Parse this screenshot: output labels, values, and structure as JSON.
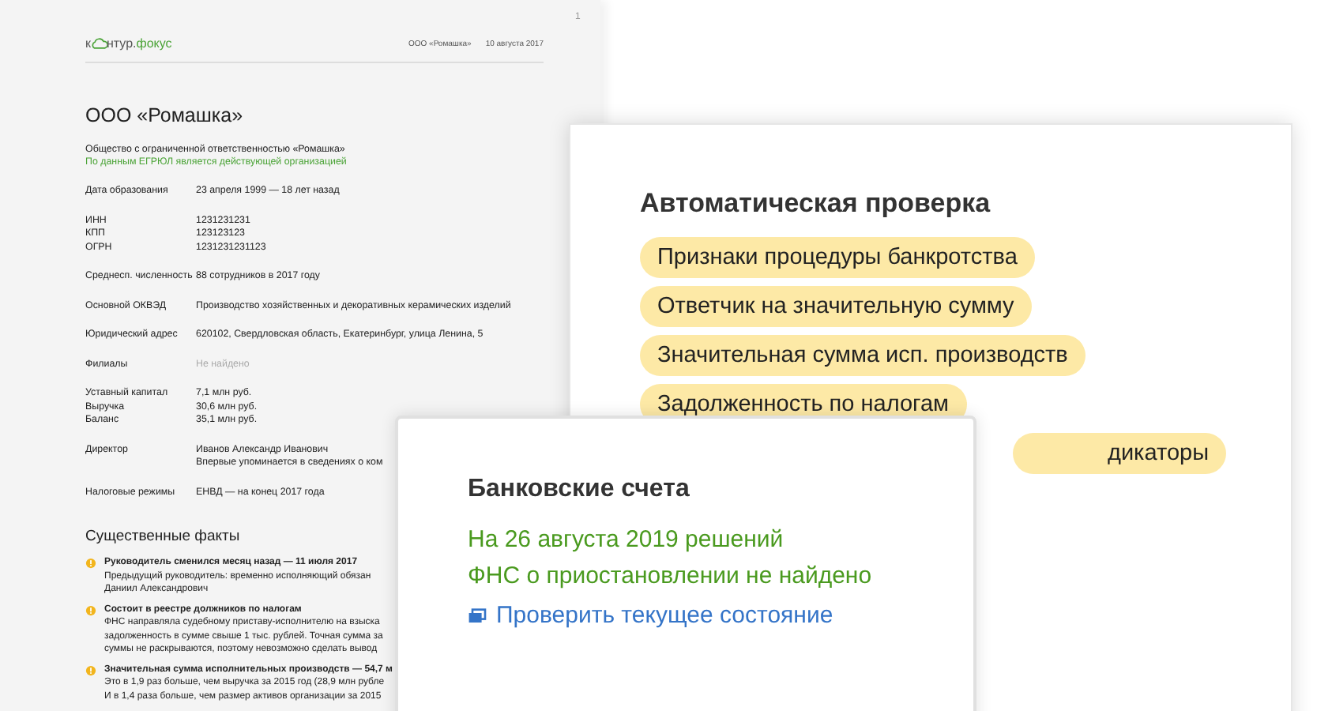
{
  "document": {
    "page_number": "1",
    "logo": {
      "start": "к",
      "middle": "нтур.",
      "product": "фокус"
    },
    "header_company": "ООО «Ромашка»",
    "header_date": "10 августа 2017",
    "title": "ООО «Ромашка»",
    "full_name": "Общество с ограниченной ответственностью «Ромашка»",
    "status": "По данным ЕГРЮЛ является действующей организацией",
    "groups": [
      {
        "rows": [
          {
            "label": "Дата образования",
            "value": "23 апреля 1999 — 18 лет назад",
            "muted": false
          }
        ]
      },
      {
        "rows": [
          {
            "label": "ИНН",
            "value": "1231231231",
            "muted": false
          },
          {
            "label": "КПП",
            "value": "123123123",
            "muted": false
          },
          {
            "label": "ОГРН",
            "value": "1231231231123",
            "muted": false
          }
        ]
      },
      {
        "rows": [
          {
            "label": "Среднесп. численность",
            "value": "88 сотрудников в 2017 году",
            "muted": false
          }
        ]
      },
      {
        "rows": [
          {
            "label": "Основной ОКВЭД",
            "value": "Производство хозяйственных и декоративных керамических изделий",
            "muted": false
          }
        ]
      },
      {
        "rows": [
          {
            "label": "Юридический адрес",
            "value": "620102, Свердловская область, Екатеринбург, улица Ленина, 5",
            "muted": false
          }
        ]
      },
      {
        "rows": [
          {
            "label": "Филиалы",
            "value": "Не найдено",
            "muted": true
          }
        ]
      },
      {
        "rows": [
          {
            "label": "Уставный капитал",
            "value": "7,1 млн руб.",
            "muted": false
          },
          {
            "label": "Выручка",
            "value": "30,6 млн руб.",
            "muted": false
          },
          {
            "label": "Баланс",
            "value": "35,1 млн руб.",
            "muted": false
          }
        ]
      },
      {
        "rows": [
          {
            "label": "Директор",
            "value": "Иванов Александр Иванович",
            "muted": false
          },
          {
            "value": "Впервые упоминается в сведениях о ком",
            "muted": false
          }
        ]
      },
      {
        "rows": [
          {
            "label": "Налоговые режимы",
            "value": "ЕНВД — на конец 2017 года",
            "muted": false
          }
        ]
      }
    ],
    "facts_title": "Существенные факты",
    "facts": [
      {
        "title": "Руководитель сменился месяц назад — 11 июля 2017",
        "lines": [
          "Предыдущий руководитель: временно исполняющий обязан",
          "Даниил Александрович"
        ]
      },
      {
        "title": "Состоит в реестре должников по налогам",
        "lines": [
          "ФНС направляла судебному приставу-исполнителю на взыска",
          "задолженность в сумме свыше 1 тыс. рублей.  Точная сумма за",
          "суммы не раскрываются, поэтому невозможно сделать вывод"
        ]
      },
      {
        "title": "Значительная сумма исполнительных производств — 54,7 м",
        "lines": [
          "Это в 1,9 раз больше, чем выручка за 2015 год (28,9 млн рубле",
          "И в 1,4 раза больше, чем размер активов организации за 2015"
        ]
      }
    ]
  },
  "auto_check": {
    "title": "Автоматическая проверка",
    "tags": [
      "Признаки процедуры банкротства",
      "Ответчик на значительную сумму",
      "Значительная сумма исп. производств",
      "Задолженность по налогам",
      "дикаторы"
    ]
  },
  "bank_accounts": {
    "title": "Банковские счета",
    "lines": [
      "На 26 августа 2019 решений",
      "ФНС о приостановлении не найдено"
    ],
    "link": "Проверить текущее состояние"
  }
}
